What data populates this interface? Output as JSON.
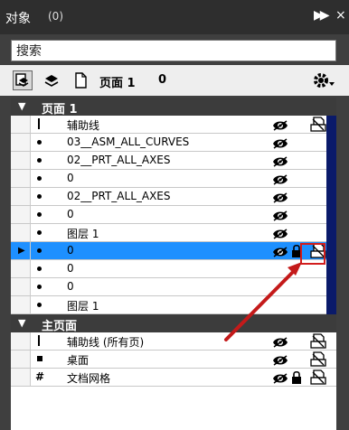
{
  "titlebar": {
    "title": "对象",
    "count": "(0)"
  },
  "search": {
    "value": "搜索"
  },
  "toolbar": {
    "page_name": "页面 1",
    "page_count": "0"
  },
  "rows": [
    {
      "kind": "header",
      "label": "页面 1"
    },
    {
      "kind": "item",
      "marker": "dash",
      "label": "辅助线",
      "eye": true,
      "lock": false,
      "print": true
    },
    {
      "kind": "item",
      "marker": "dot",
      "label": "03__ASM_ALL_CURVES",
      "eye": true,
      "lock": false,
      "print": false
    },
    {
      "kind": "item",
      "marker": "dot",
      "label": "02__PRT_ALL_AXES",
      "eye": true,
      "lock": false,
      "print": false
    },
    {
      "kind": "item",
      "marker": "dot",
      "label": "0",
      "eye": true,
      "lock": false,
      "print": false
    },
    {
      "kind": "item",
      "marker": "dot",
      "label": "02__PRT_ALL_AXES",
      "eye": true,
      "lock": false,
      "print": false
    },
    {
      "kind": "item",
      "marker": "dot",
      "label": "0",
      "eye": true,
      "lock": false,
      "print": false
    },
    {
      "kind": "item",
      "marker": "dot",
      "label": "图层 1",
      "eye": true,
      "lock": false,
      "print": false
    },
    {
      "kind": "selected",
      "marker": "dot",
      "label": "0",
      "eye": true,
      "lock": true,
      "print": true
    },
    {
      "kind": "item",
      "marker": "dot",
      "label": "0",
      "eye": false,
      "lock": false,
      "print": false
    },
    {
      "kind": "item",
      "marker": "dot",
      "label": "0",
      "eye": false,
      "lock": false,
      "print": false
    },
    {
      "kind": "item",
      "marker": "dot",
      "label": "图层 1",
      "eye": false,
      "lock": false,
      "print": false
    },
    {
      "kind": "header",
      "label": "主页面"
    },
    {
      "kind": "item",
      "marker": "dash",
      "label": "辅助线 (所有页)",
      "eye": true,
      "lock": false,
      "print": true
    },
    {
      "kind": "item",
      "marker": "sq",
      "label": "桌面",
      "eye": true,
      "lock": false,
      "print": true
    },
    {
      "kind": "item",
      "marker": "hash",
      "label": "文档网格",
      "eye": true,
      "lock": true,
      "print": true
    }
  ]
}
